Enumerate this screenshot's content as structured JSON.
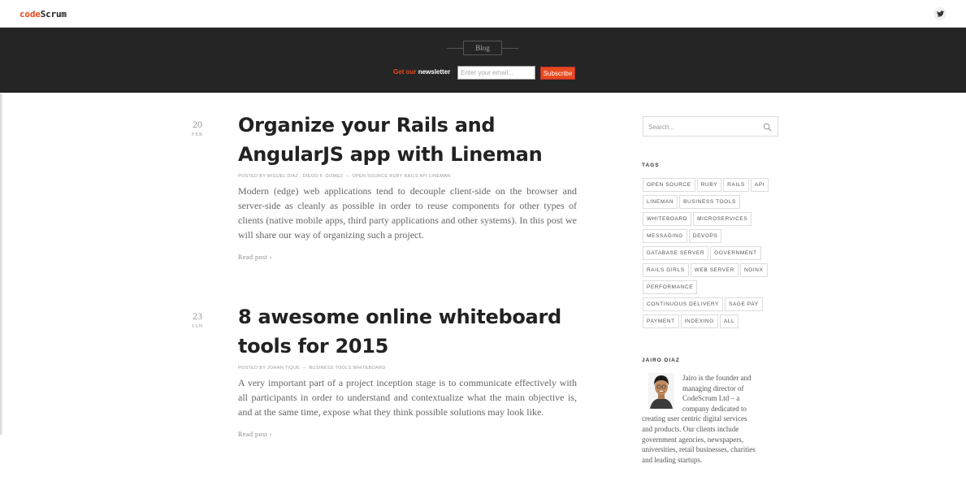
{
  "header": {
    "logo_code": "code",
    "logo_scrum": "Scrum",
    "twitter_icon": "twitter-icon"
  },
  "hero": {
    "blog_label": "Blog",
    "newsletter_prefix": "Get our",
    "newsletter_word": "newsletter",
    "email_placeholder": "Enter your email...",
    "subscribe_label": "Subscribe"
  },
  "posts": [
    {
      "day": "20",
      "month": "FEB",
      "title_line1": "Organize your Rails and",
      "title_line2": "AngularJS app with Lineman",
      "meta_author": "POSTED BY MIGUEL DIAZ , DIEGO F. GOMEZ",
      "meta_tags": "OPEN SOURCE RUBY RAILS API LINEMAN",
      "excerpt": "Modern (edge) web applications tend to decouple client-side on the browser and server-side as cleanly as possible in order to reuse components for other types of clients (native mobile apps, third party applications and other systems). In this post we will share our way of organizing such a project.",
      "read_more": "Read post ›"
    },
    {
      "day": "23",
      "month": "JAN",
      "title_line1": "8 awesome online whiteboard",
      "title_line2": "tools for 2015",
      "meta_author": "POSTED BY JOHAN TIQUE",
      "meta_tags": "BUSINESS TOOLS WHITEBOARD",
      "excerpt": "A very important part of a project inception stage is to communicate effectively with all participants in order to understand and contextualize what the main objective is, and at the same time, expose what they think possible solutions may look like.",
      "read_more": "Read post ›"
    }
  ],
  "sidebar": {
    "search_placeholder": "Search...",
    "tags_heading": "TAGS",
    "tag_rows": [
      [
        "OPEN SOURCE",
        "RUBY",
        "RAILS",
        "API"
      ],
      [
        "LINEMAN",
        "BUSINESS TOOLS"
      ],
      [
        "WHITEBOARD",
        "MICROSERVICES"
      ],
      [
        "MESSAGING",
        "DEVOPS"
      ],
      [
        "DATABASE SERVER",
        "GOVERNMENT"
      ],
      [
        "RAILS GIRLS",
        "WEB SERVER",
        "NGINX"
      ],
      [
        "PERFORMANCE"
      ],
      [
        "CONTINUOUS DELIVERY",
        "SAGE PAY"
      ],
      [
        "PAYMENT",
        "INDEXING",
        "ALL"
      ]
    ],
    "author_heading": "JAIRO DIAZ",
    "author_bio_lines": [
      "Jairo is the founder and",
      "managing director of",
      "CodeScrum Ltd – a",
      "company dedicated to",
      "creating user centric digital services",
      "and products. Our clients include",
      "government agencies, newspapers,",
      "universities, retail businesses, charities",
      "and leading startups."
    ]
  },
  "colors": {
    "accent": "#e8491d",
    "hero_bg": "#252525"
  }
}
